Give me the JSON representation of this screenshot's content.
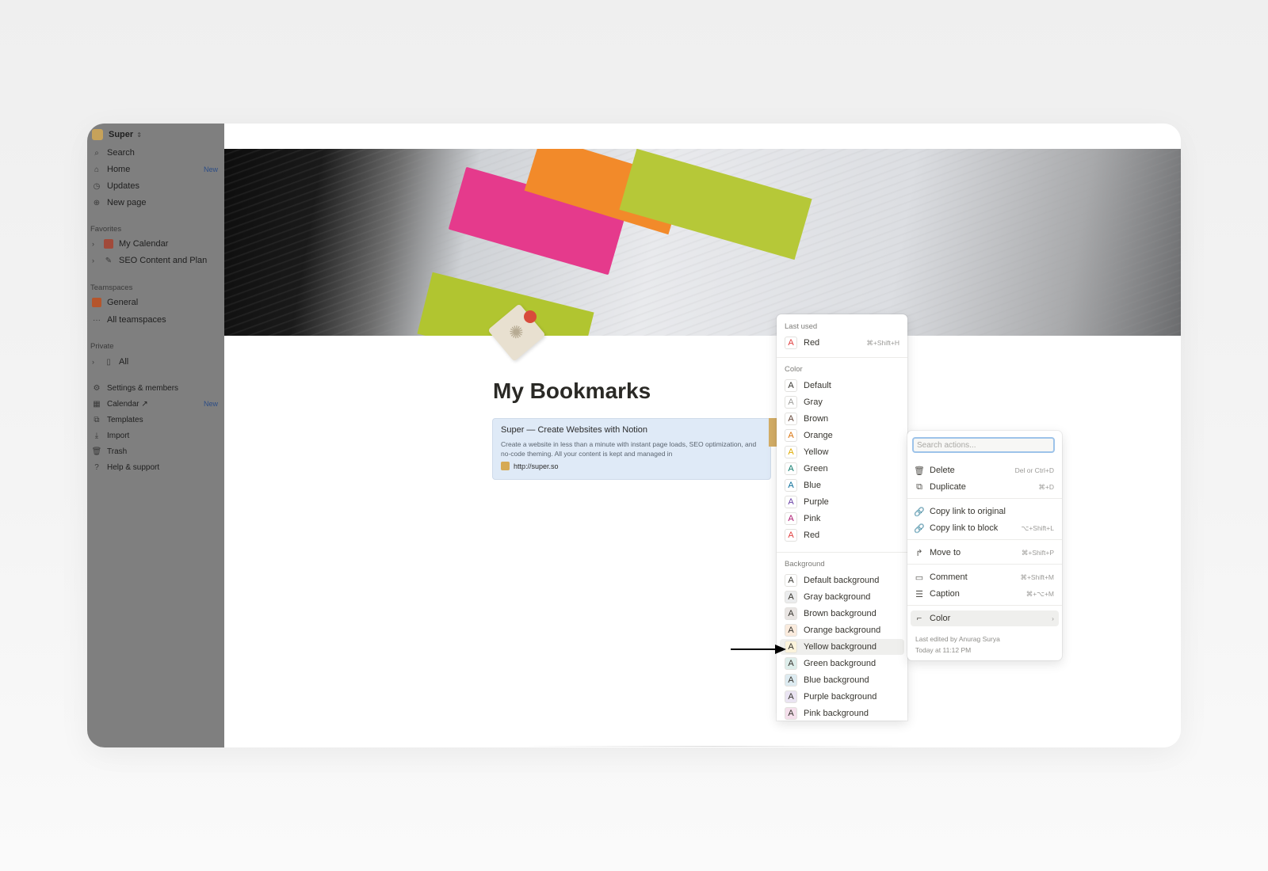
{
  "sidebar": {
    "workspace": "Super",
    "workspace_chevron": "⇕",
    "nav": [
      {
        "label": "Search",
        "icon": "search-icon"
      },
      {
        "label": "Home",
        "icon": "home-icon",
        "badge": "New"
      },
      {
        "label": "Updates",
        "icon": "clock-icon"
      },
      {
        "label": "New page",
        "icon": "plus-circle-icon"
      }
    ],
    "favorites_label": "Favorites",
    "favorites": [
      "My Calendar",
      "SEO Content and Plan"
    ],
    "teamspaces_label": "Teamspaces",
    "teamspaces": [
      "General",
      "All teamspaces"
    ],
    "private_label": "Private",
    "private": [
      "All"
    ],
    "bottom": [
      {
        "label": "Settings & members"
      },
      {
        "label": "Calendar ↗",
        "badge": "New"
      },
      {
        "label": "Templates"
      },
      {
        "label": "Import"
      },
      {
        "label": "Trash"
      },
      {
        "label": "Help & support"
      }
    ]
  },
  "page": {
    "title": "My Bookmarks",
    "bookmark": {
      "title": "Super — Create Websites with Notion",
      "description": "Create a website in less than a minute with instant page loads, SEO optimization, and no-code theming. All your content is kept and managed in",
      "url": "http://super.so"
    }
  },
  "color_menu": {
    "last_used_label": "Last used",
    "last_used": {
      "label": "Red",
      "shortcut": "⌘+Shift+H",
      "color": "#e03e3e"
    },
    "color_label": "Color",
    "colors": [
      {
        "label": "Default",
        "color": "#37352f"
      },
      {
        "label": "Gray",
        "color": "#9b9a97"
      },
      {
        "label": "Brown",
        "color": "#64473a"
      },
      {
        "label": "Orange",
        "color": "#d9730d"
      },
      {
        "label": "Yellow",
        "color": "#dfab01"
      },
      {
        "label": "Green",
        "color": "#0f7b6c"
      },
      {
        "label": "Blue",
        "color": "#0b6e99"
      },
      {
        "label": "Purple",
        "color": "#6940a5"
      },
      {
        "label": "Pink",
        "color": "#ad1a72"
      },
      {
        "label": "Red",
        "color": "#e03e3e"
      }
    ],
    "background_label": "Background",
    "backgrounds": [
      {
        "label": "Default background",
        "bg": "#ffffff"
      },
      {
        "label": "Gray background",
        "bg": "#ebeced"
      },
      {
        "label": "Brown background",
        "bg": "#e9e5e3"
      },
      {
        "label": "Orange background",
        "bg": "#faebdd"
      },
      {
        "label": "Yellow background",
        "bg": "#fbf3db"
      },
      {
        "label": "Green background",
        "bg": "#ddedea"
      },
      {
        "label": "Blue background",
        "bg": "#ddebf1"
      },
      {
        "label": "Purple background",
        "bg": "#eae4f2"
      },
      {
        "label": "Pink background",
        "bg": "#f4dfeb"
      }
    ],
    "glyph": "A",
    "highlighted": "Yellow background"
  },
  "action_menu": {
    "search_placeholder": "Search actions...",
    "items": [
      {
        "label": "Delete",
        "shortcut": "Del or Ctrl+D",
        "icon": "trash-icon"
      },
      {
        "label": "Duplicate",
        "shortcut": "⌘+D",
        "icon": "duplicate-icon"
      },
      {
        "label": "Copy link to original",
        "shortcut": "",
        "icon": "link-icon"
      },
      {
        "label": "Copy link to block",
        "shortcut": "⌥+Shift+L",
        "icon": "link-icon"
      },
      {
        "label": "Move to",
        "shortcut": "⌘+Shift+P",
        "icon": "arrow-right-icon"
      },
      {
        "label": "Comment",
        "shortcut": "⌘+Shift+M",
        "icon": "comment-icon"
      },
      {
        "label": "Caption",
        "shortcut": "⌘+⌥+M",
        "icon": "caption-icon"
      },
      {
        "label": "Color",
        "shortcut": "›",
        "icon": "paint-roller-icon"
      }
    ],
    "footer_line1": "Last edited by Anurag Surya",
    "footer_line2": "Today at 11:12 PM"
  }
}
